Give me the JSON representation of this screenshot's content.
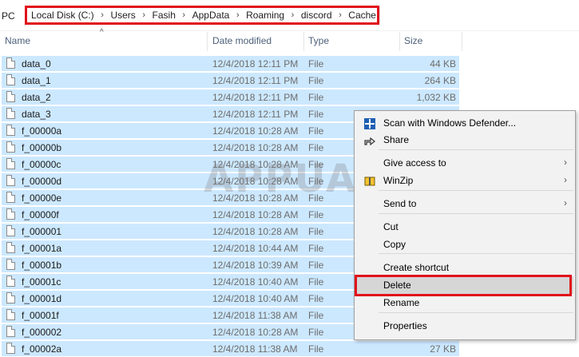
{
  "breadcrumb": {
    "lead": "PC",
    "items": [
      "Local Disk (C:)",
      "Users",
      "Fasih",
      "AppData",
      "Roaming",
      "discord",
      "Cache"
    ],
    "separator": "›"
  },
  "columns": {
    "name": "Name",
    "date": "Date modified",
    "type": "Type",
    "size": "Size"
  },
  "files": [
    {
      "name": "data_0",
      "date": "12/4/2018 12:11 PM",
      "type": "File",
      "size": "44 KB"
    },
    {
      "name": "data_1",
      "date": "12/4/2018 12:11 PM",
      "type": "File",
      "size": "264 KB"
    },
    {
      "name": "data_2",
      "date": "12/4/2018 12:11 PM",
      "type": "File",
      "size": "1,032 KB"
    },
    {
      "name": "data_3",
      "date": "12/4/2018 12:11 PM",
      "type": "File",
      "size": ""
    },
    {
      "name": "f_00000a",
      "date": "12/4/2018 10:28 AM",
      "type": "File",
      "size": ""
    },
    {
      "name": "f_00000b",
      "date": "12/4/2018 10:28 AM",
      "type": "File",
      "size": ""
    },
    {
      "name": "f_00000c",
      "date": "12/4/2018 10:28 AM",
      "type": "File",
      "size": ""
    },
    {
      "name": "f_00000d",
      "date": "12/4/2018 10:28 AM",
      "type": "File",
      "size": ""
    },
    {
      "name": "f_00000e",
      "date": "12/4/2018 10:28 AM",
      "type": "File",
      "size": ""
    },
    {
      "name": "f_00000f",
      "date": "12/4/2018 10:28 AM",
      "type": "File",
      "size": ""
    },
    {
      "name": "f_000001",
      "date": "12/4/2018 10:28 AM",
      "type": "File",
      "size": ""
    },
    {
      "name": "f_00001a",
      "date": "12/4/2018 10:44 AM",
      "type": "File",
      "size": ""
    },
    {
      "name": "f_00001b",
      "date": "12/4/2018 10:39 AM",
      "type": "File",
      "size": ""
    },
    {
      "name": "f_00001c",
      "date": "12/4/2018 10:40 AM",
      "type": "File",
      "size": ""
    },
    {
      "name": "f_00001d",
      "date": "12/4/2018 10:40 AM",
      "type": "File",
      "size": ""
    },
    {
      "name": "f_00001f",
      "date": "12/4/2018 11:38 AM",
      "type": "File",
      "size": ""
    },
    {
      "name": "f_000002",
      "date": "12/4/2018 10:28 AM",
      "type": "File",
      "size": ""
    },
    {
      "name": "f_00002a",
      "date": "12/4/2018 11:38 AM",
      "type": "File",
      "size": "27 KB"
    }
  ],
  "watermark": "APPUALS",
  "context_menu": {
    "items": [
      {
        "label": "Scan with Windows Defender...",
        "icon": "windows-defender-icon",
        "submenu": false
      },
      {
        "label": "Share",
        "icon": "share-icon",
        "submenu": false
      },
      {
        "label": "Give access to",
        "icon": "",
        "submenu": true
      },
      {
        "label": "WinZip",
        "icon": "winzip-icon",
        "submenu": true
      },
      {
        "label": "Send to",
        "icon": "",
        "submenu": true
      },
      {
        "label": "Cut",
        "icon": "",
        "submenu": false
      },
      {
        "label": "Copy",
        "icon": "",
        "submenu": false
      },
      {
        "label": "Create shortcut",
        "icon": "",
        "submenu": false
      },
      {
        "label": "Delete",
        "icon": "",
        "submenu": false,
        "highlighted": true
      },
      {
        "label": "Rename",
        "icon": "",
        "submenu": false
      },
      {
        "label": "Properties",
        "icon": "",
        "submenu": false
      }
    ],
    "submenu_arrow": "›"
  },
  "colors": {
    "selection": "#cce8ff",
    "highlight_box": "#e0131b",
    "menu_bg": "#f2f2f2",
    "menu_hover": "#d6d6d6"
  }
}
